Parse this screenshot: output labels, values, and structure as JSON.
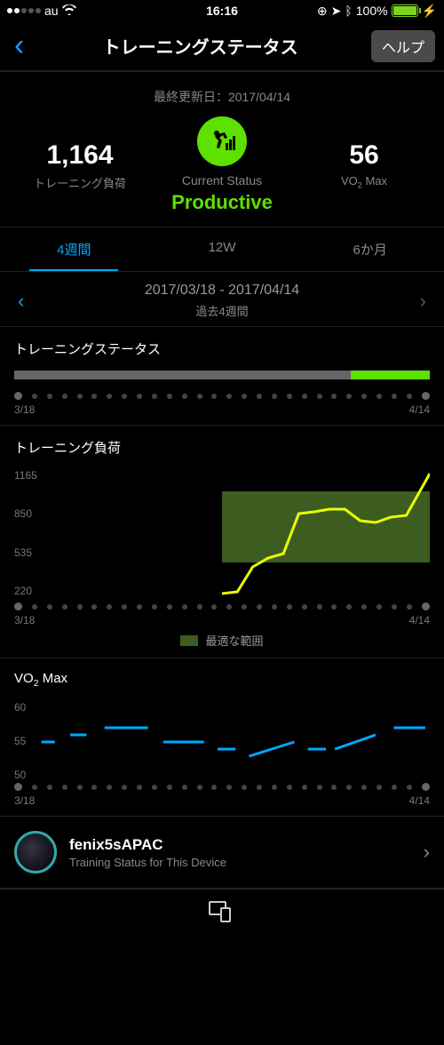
{
  "status_bar": {
    "carrier": "au",
    "time": "16:16",
    "battery": "100%"
  },
  "nav": {
    "title": "トレーニングステータス",
    "help": "ヘルプ"
  },
  "hero": {
    "last_update": "最終更新日：2017/04/14",
    "load_value": "1,164",
    "load_label": "トレーニング負荷",
    "status_label": "Current Status",
    "status_value": "Productive",
    "vo2_value": "56",
    "vo2_label": "VO₂ Max"
  },
  "tabs": {
    "t1": "4週間",
    "t2": "12W",
    "t3": "6か月"
  },
  "date": {
    "range": "2017/03/18 - 2017/04/14",
    "sub": "過去4週間"
  },
  "axis": {
    "start": "3/18",
    "end": "4/14"
  },
  "status_chart": {
    "title": "トレーニングステータス"
  },
  "load_chart": {
    "title": "トレーニング負荷",
    "yticks": [
      "1165",
      "850",
      "535",
      "220"
    ],
    "legend": "最適な範囲"
  },
  "vo2_chart": {
    "title": "VO₂ Max",
    "yticks": [
      "60",
      "55",
      "50"
    ]
  },
  "device": {
    "name": "fenix5sAPAC",
    "sub": "Training Status for This Device"
  },
  "chart_data": [
    {
      "type": "bar",
      "title": "トレーニングステータス",
      "x_start": "3/18",
      "x_end": "4/14",
      "range_days": 28,
      "productive_days_from_end": 5,
      "note": "grey=base, green=Productive portion at right"
    },
    {
      "type": "line",
      "title": "トレーニング負荷",
      "xlabel": "",
      "ylabel": "",
      "ylim": [
        220,
        1165
      ],
      "x_start": "3/18",
      "x_end": "4/14",
      "optimal_band": [
        500,
        1000
      ],
      "x": [
        14,
        15,
        16,
        17,
        18,
        19,
        20,
        21,
        22,
        23,
        24,
        25,
        26,
        27
      ],
      "values": [
        280,
        290,
        470,
        535,
        570,
        850,
        870,
        890,
        890,
        810,
        800,
        840,
        850,
        1164
      ]
    },
    {
      "type": "line",
      "title": "VO₂ Max",
      "ylim": [
        50,
        60
      ],
      "x_start": "3/18",
      "x_end": "4/14",
      "segments": [
        {
          "x": [
            0,
            1
          ],
          "y": [
            55,
            55
          ]
        },
        {
          "x": [
            2,
            3
          ],
          "y": [
            56,
            56
          ]
        },
        {
          "x": [
            4,
            7
          ],
          "y": [
            57,
            57
          ]
        },
        {
          "x": [
            8,
            11
          ],
          "y": [
            55,
            55
          ]
        },
        {
          "x": [
            12,
            13
          ],
          "y": [
            54,
            54
          ]
        },
        {
          "x": [
            14,
            17
          ],
          "y": [
            53,
            55
          ]
        },
        {
          "x": [
            18,
            19
          ],
          "y": [
            54,
            54
          ]
        },
        {
          "x": [
            20,
            23
          ],
          "y": [
            54,
            56
          ]
        },
        {
          "x": [
            25,
            27
          ],
          "y": [
            57,
            57
          ]
        }
      ]
    }
  ]
}
